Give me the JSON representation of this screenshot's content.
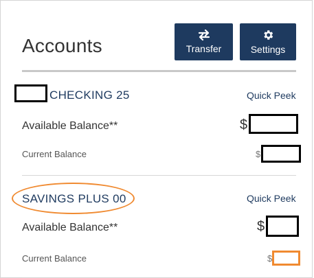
{
  "header": {
    "title": "Accounts",
    "transfer_label": "Transfer",
    "settings_label": "Settings"
  },
  "accounts": [
    {
      "name": "CHECKING 25",
      "quick_peek": "Quick Peek",
      "available_label": "Available Balance**",
      "current_label": "Current Balance",
      "currency": "$"
    },
    {
      "name": "SAVINGS PLUS 00",
      "quick_peek": "Quick Peek",
      "available_label": "Available Balance**",
      "current_label": "Current Balance",
      "currency": "$"
    }
  ],
  "colors": {
    "brand": "#1e3a5f",
    "highlight": "#f08a30",
    "redaction": "#000000"
  },
  "icons": {
    "transfer": "swap-arrows-icon",
    "settings": "gear-icon"
  }
}
